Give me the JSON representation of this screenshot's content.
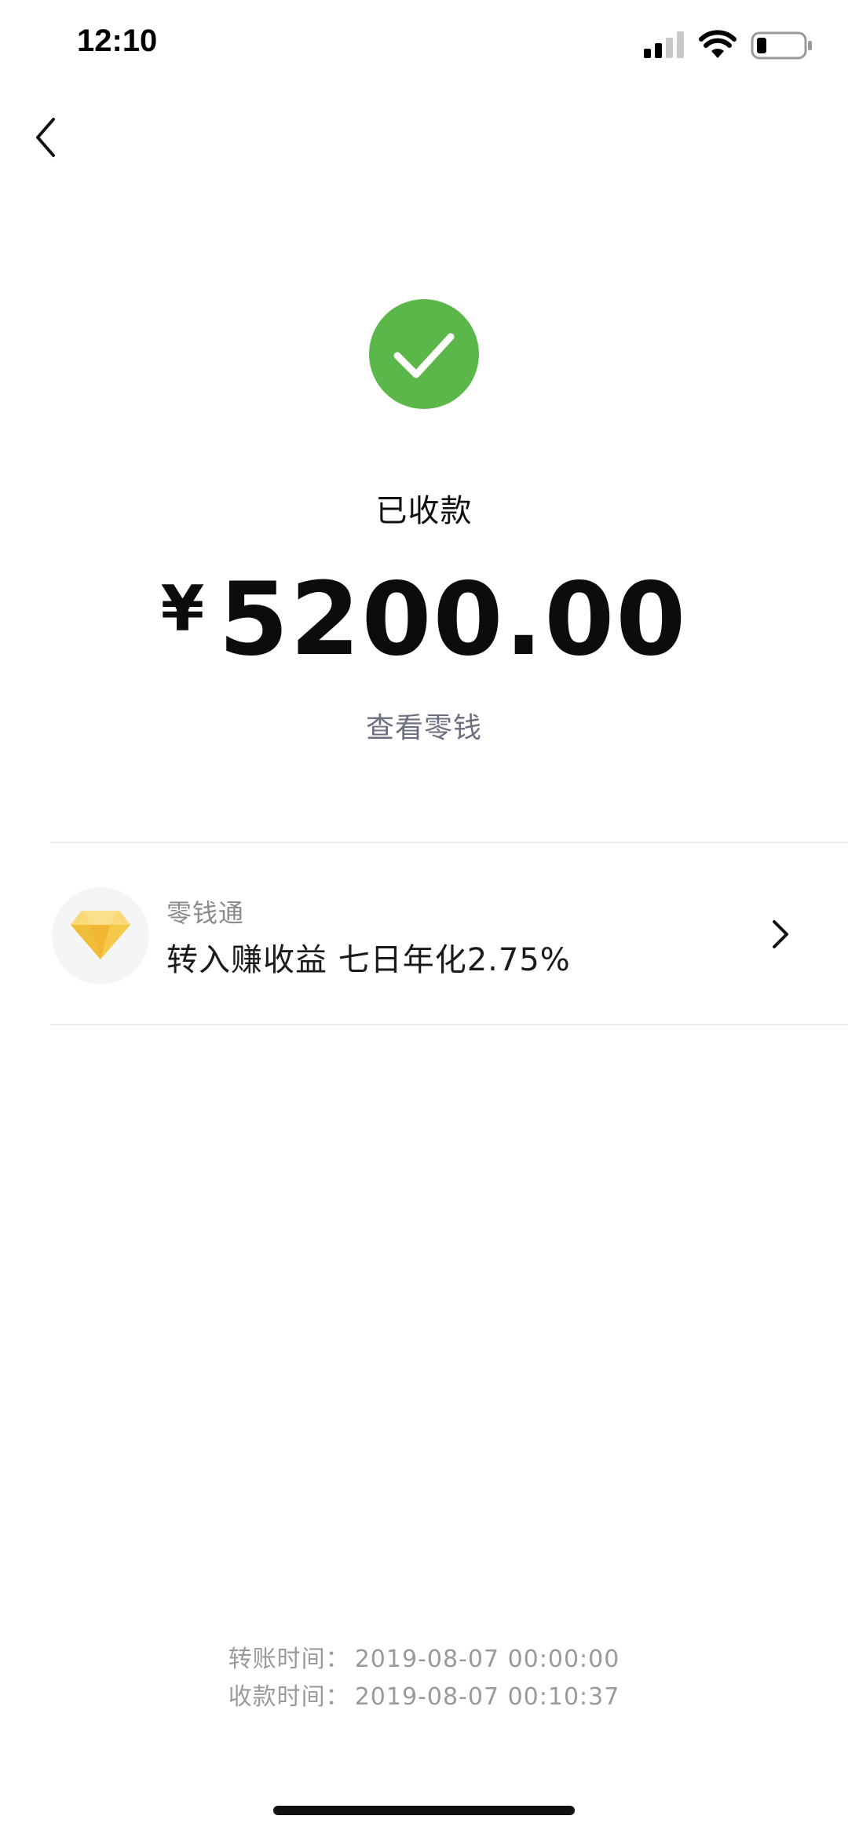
{
  "status_bar": {
    "time": "12:10",
    "icons": [
      "signal-icon",
      "wifi-icon",
      "battery-icon"
    ]
  },
  "nav": {
    "back_icon": "chevron-left-icon"
  },
  "result": {
    "icon": "check-circle-icon",
    "accent_color": "#5bb749",
    "status_text": "已收款",
    "currency_symbol": "¥",
    "amount": "5200.00",
    "view_change_label": "查看零钱"
  },
  "promo": {
    "icon": "diamond-icon",
    "title": "零钱通",
    "description": "转入赚收益 七日年化2.75%",
    "chevron": "chevron-right-icon"
  },
  "times": {
    "transfer_label": "转账时间：",
    "transfer_time": "2019-08-07 00:00:00",
    "receive_label": "收款时间：",
    "receive_time": "2019-08-07 00:10:37"
  }
}
